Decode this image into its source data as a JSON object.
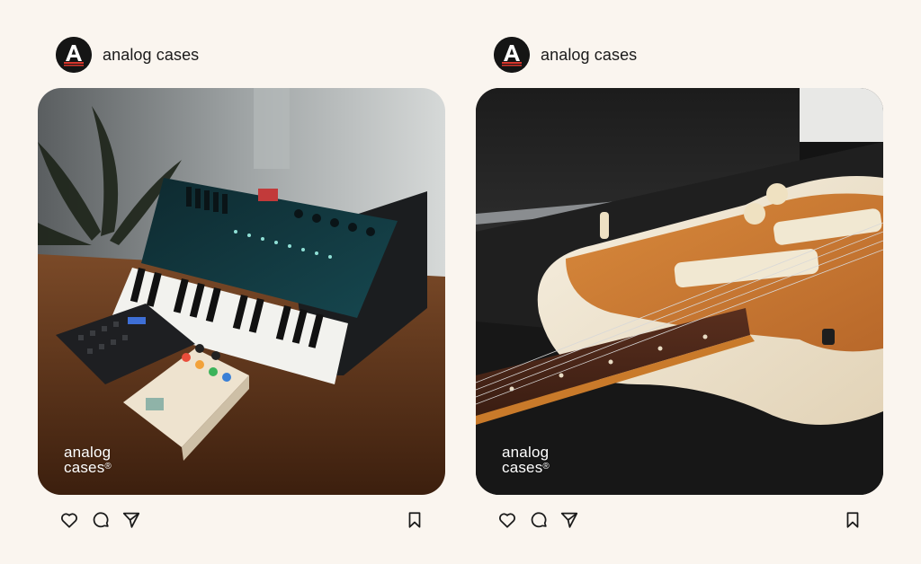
{
  "posts": [
    {
      "account": {
        "username": "analog cases",
        "avatar_icon": "analog-cases-logo-icon"
      },
      "photo": {
        "subject": "synthesizer-on-stand",
        "watermark": "analog cases",
        "watermark_line1": "analog",
        "watermark_line2": "cases",
        "watermark_mark": "®"
      },
      "actions": [
        "heart-icon",
        "comment-icon",
        "share-icon",
        "bookmark-icon"
      ]
    },
    {
      "account": {
        "username": "analog cases",
        "avatar_icon": "analog-cases-logo-icon"
      },
      "photo": {
        "subject": "guitar-in-case",
        "watermark": "analog cases",
        "watermark_line1": "analog",
        "watermark_line2": "cases",
        "watermark_mark": "®"
      },
      "actions": [
        "heart-icon",
        "comment-icon",
        "share-icon",
        "bookmark-icon"
      ]
    }
  ],
  "colors": {
    "background": "#faf5ef",
    "avatar": "#151515",
    "avatar_letter": "#ffffff",
    "avatar_stripe": "#d9362c",
    "icon": "#1a1a1a"
  }
}
